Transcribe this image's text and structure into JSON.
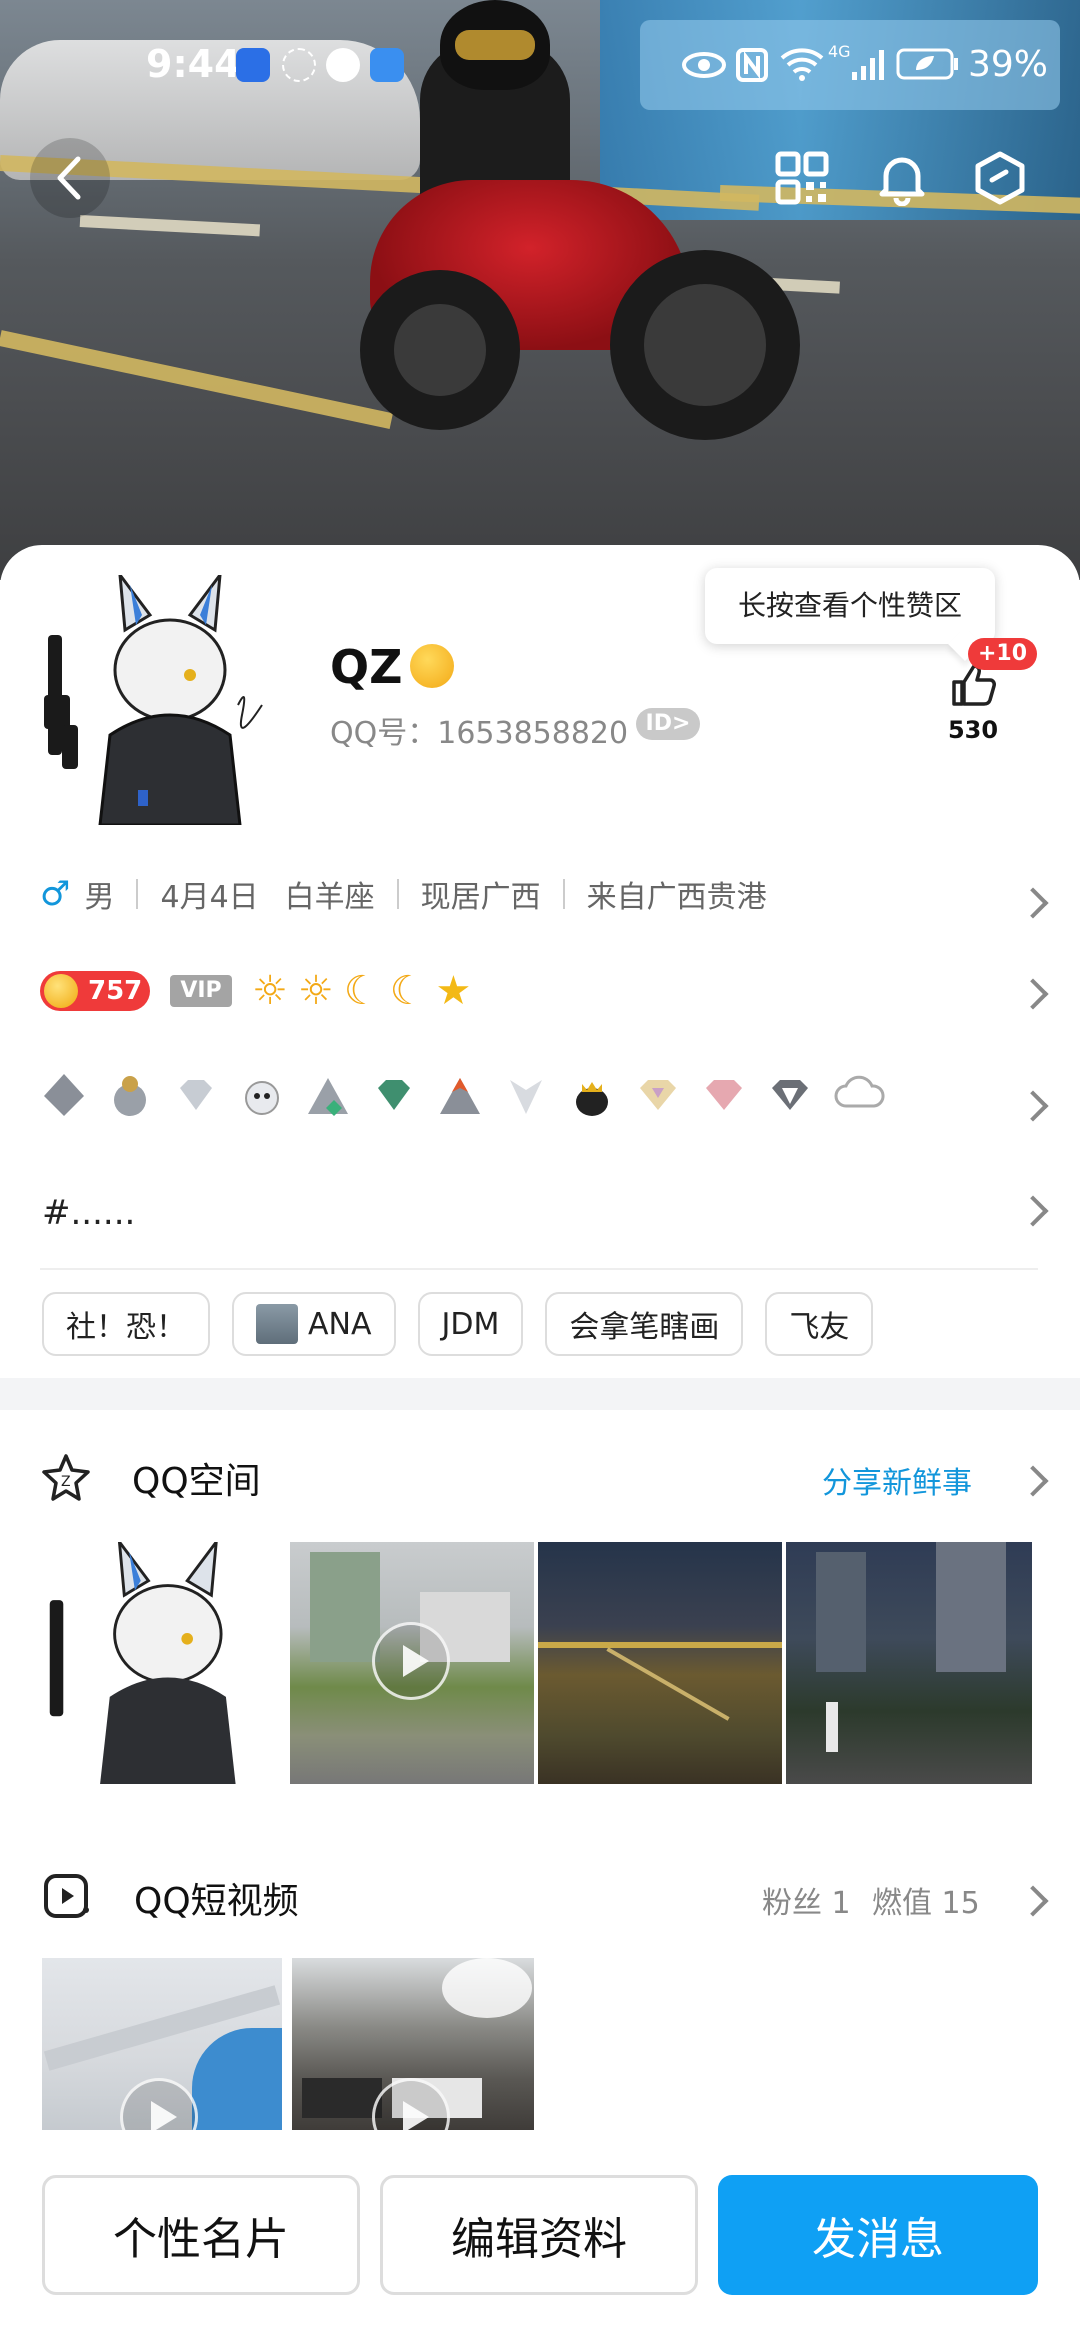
{
  "status_bar": {
    "time": "9:44",
    "battery_percent": "39%",
    "network": "4G"
  },
  "header": {
    "back_icon": "chevron-left-icon",
    "qr_icon": "qr-code-icon",
    "bell_icon": "bell-icon",
    "settings_icon": "hexagon-settings-icon"
  },
  "profile": {
    "name": "QZ",
    "qq_number": "QQ号：1653858820",
    "id_badge": "ID>",
    "like_tooltip": "长按查看个性赞区",
    "like_badge": "+10",
    "like_count": "530"
  },
  "info": {
    "gender": "男",
    "birthday": "4月4日",
    "zodiac": "白羊座",
    "location": "现居广西",
    "hometown": "来自广西贵港"
  },
  "level": {
    "coin_value": "757",
    "vip_label": "VIP"
  },
  "signature": "#......",
  "tags": [
    "社！恐！",
    "ANA",
    "JDM",
    "会拿笔瞎画",
    "飞友"
  ],
  "qzone": {
    "title": "QQ空间",
    "action": "分享新鲜事"
  },
  "short_video": {
    "title": "QQ短视频",
    "fans": "粉丝 1",
    "heat": "燃值 15"
  },
  "buttons": {
    "card": "个性名片",
    "edit": "编辑资料",
    "message": "发消息"
  },
  "colors": {
    "accent": "#1296db",
    "primary_button": "#0fa0f4",
    "badge_red": "#ef3a3a"
  }
}
